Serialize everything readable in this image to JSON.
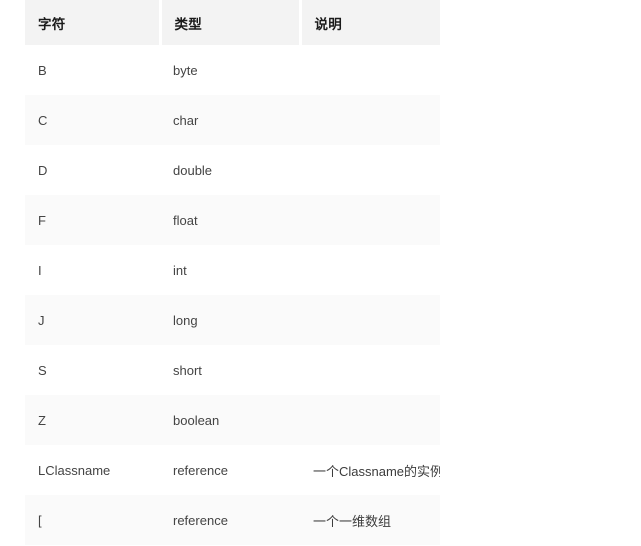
{
  "table": {
    "columns": [
      {
        "key": "char",
        "label": "字符"
      },
      {
        "key": "type",
        "label": "类型"
      },
      {
        "key": "desc",
        "label": "说明"
      }
    ],
    "rows": [
      {
        "char": "B",
        "type": "byte",
        "desc": ""
      },
      {
        "char": "C",
        "type": "char",
        "desc": ""
      },
      {
        "char": "D",
        "type": "double",
        "desc": ""
      },
      {
        "char": "F",
        "type": "float",
        "desc": ""
      },
      {
        "char": "I",
        "type": "int",
        "desc": ""
      },
      {
        "char": "J",
        "type": "long",
        "desc": ""
      },
      {
        "char": "S",
        "type": "short",
        "desc": ""
      },
      {
        "char": "Z",
        "type": "boolean",
        "desc": ""
      },
      {
        "char": "LClassname",
        "type": "reference",
        "desc": "一个Classname的实例"
      },
      {
        "char": "[",
        "type": "reference",
        "desc": "一个一维数组"
      }
    ]
  },
  "colors": {
    "page_background": "#ffffff",
    "header_background": "#f3f3f3",
    "header_text": "#1a1a1a",
    "row_odd_background": "#ffffff",
    "row_even_background": "#fafafa",
    "cell_text": "#444444"
  }
}
